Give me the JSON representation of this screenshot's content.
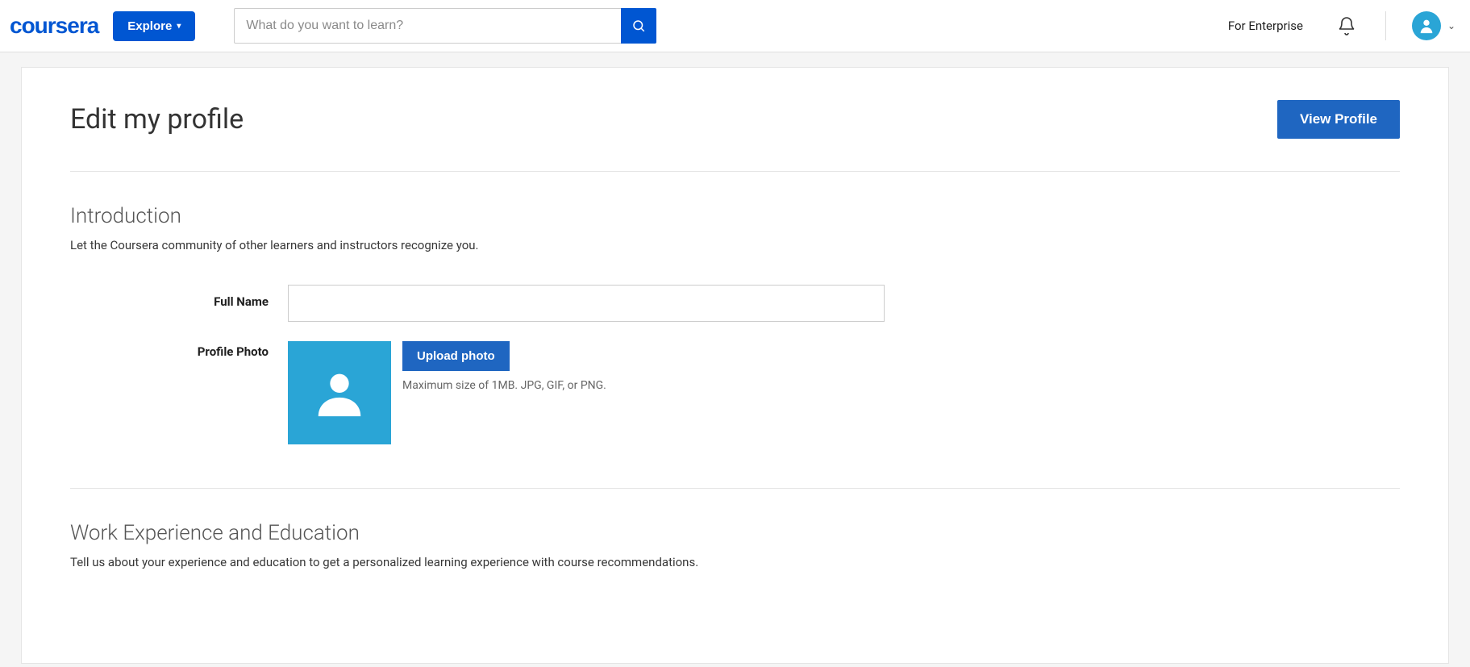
{
  "header": {
    "logo_text": "coursera",
    "explore_label": "Explore",
    "search_placeholder": "What do you want to learn?",
    "search_value": "",
    "enterprise_label": "For Enterprise"
  },
  "page": {
    "title": "Edit my profile",
    "view_profile_label": "View Profile"
  },
  "introduction": {
    "heading": "Introduction",
    "description": "Let the Coursera community of other learners and instructors recognize you.",
    "full_name_label": "Full Name",
    "full_name_value": "",
    "profile_photo_label": "Profile Photo",
    "upload_label": "Upload photo",
    "upload_hint": "Maximum size of 1MB. JPG, GIF, or PNG."
  },
  "work": {
    "heading": "Work Experience and Education",
    "description": "Tell us about your experience and education to get a personalized learning experience with course recommendations."
  },
  "colors": {
    "brand_blue": "#0056d2",
    "button_blue": "#1f66c1",
    "avatar_teal": "#2aa5d6"
  }
}
